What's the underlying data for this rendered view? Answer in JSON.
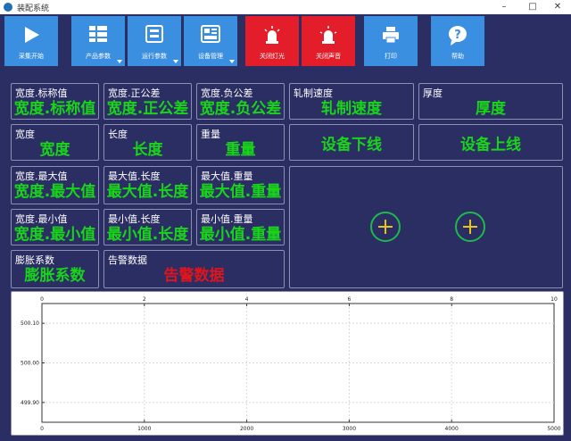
{
  "window": {
    "title": "装配系统"
  },
  "toolbar": {
    "buttons": [
      {
        "label": "采集开始",
        "icon": "play-icon"
      },
      {
        "label": "产品参数",
        "icon": "grid-icon"
      },
      {
        "label": "运行参数",
        "icon": "panel-icon"
      },
      {
        "label": "设备管理",
        "icon": "device-icon"
      },
      {
        "label": "关闭灯光",
        "icon": "light-icon"
      },
      {
        "label": "关闭声音",
        "icon": "siren-icon"
      },
      {
        "label": "打印",
        "icon": "printer-icon"
      },
      {
        "label": "帮助",
        "icon": "help-icon"
      }
    ]
  },
  "panel": {
    "width_nominal": {
      "caption": "宽度.标称值",
      "value": "宽度.标称值"
    },
    "width_plus_tol": {
      "caption": "宽度.正公差",
      "value": "宽度.正公差"
    },
    "width_minus_tol": {
      "caption": "宽度.负公差",
      "value": "宽度.负公差"
    },
    "rolling_speed": {
      "caption": "轧制速度",
      "value": "轧制速度"
    },
    "thickness": {
      "caption": "厚度",
      "value": "厚度"
    },
    "width": {
      "caption": "宽度",
      "value": "宽度"
    },
    "length": {
      "caption": "长度",
      "value": "长度"
    },
    "weight": {
      "caption": "重量",
      "value": "重量"
    },
    "device_offline": "设备下线",
    "device_online": "设备上线",
    "width_max": {
      "caption": "宽度.最大值",
      "value": "宽度.最大值"
    },
    "max_length": {
      "caption": "最大值.长度",
      "value": "最大值.长度"
    },
    "max_weight": {
      "caption": "最大值.重量",
      "value": "最大值.重量"
    },
    "width_min": {
      "caption": "宽度.最小值",
      "value": "宽度.最小值"
    },
    "min_length": {
      "caption": "最小值.长度",
      "value": "最小值.长度"
    },
    "min_weight": {
      "caption": "最小值.重量",
      "value": "最小值.重量"
    },
    "expansion": {
      "caption": "膨胀系数",
      "value": "膨胀系数"
    },
    "alarm": {
      "caption": "告警数据",
      "value": "告警数据"
    }
  },
  "colors": {
    "value_green": "#19d41b",
    "alarm_red": "#e0141c",
    "tool_blue": "#3b8fe0",
    "tool_red": "#e31e2a"
  },
  "chart_data": {
    "type": "line",
    "x_top_ticks": [
      "0",
      "2",
      "4",
      "6",
      "8",
      "10"
    ],
    "x_bottom_ticks": [
      "0",
      "1000",
      "2000",
      "3000",
      "4000",
      "5000"
    ],
    "y_ticks": [
      "500.10",
      "500.00",
      "499.90"
    ],
    "xlim": [
      0,
      5000
    ],
    "ylim": [
      499.85,
      500.15
    ],
    "series": [],
    "grid": true
  }
}
